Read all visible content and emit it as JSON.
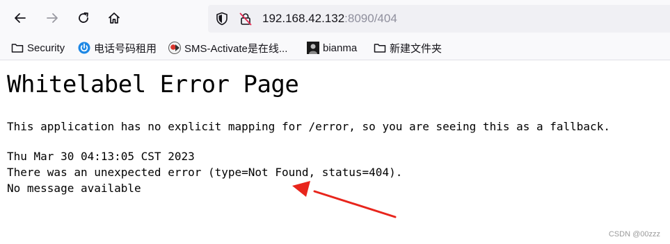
{
  "browser": {
    "url_host": "192.168.42.132",
    "url_rest": ":8090/404",
    "bookmarks": [
      {
        "label": "Security",
        "icon": "folder-icon"
      },
      {
        "label": "电话号码租用",
        "icon": "power-logo-icon"
      },
      {
        "label": "SMS-Activate是在线...",
        "icon": "sms-activate-logo-icon"
      },
      {
        "label": "bianma",
        "icon": "dark-avatar-icon"
      },
      {
        "label": "新建文件夹",
        "icon": "folder-icon"
      }
    ]
  },
  "page": {
    "title": "Whitelabel Error Page",
    "lines": [
      "This application has no explicit mapping for /error, so you are seeing this as a fallback.",
      "Thu Mar 30 04:13:05 CST 2023",
      "There was an unexpected error (type=Not Found, status=404).",
      "No message available"
    ]
  },
  "annotation": {
    "arrow_color": "#e8251c"
  },
  "watermark": "CSDN @00zzz"
}
